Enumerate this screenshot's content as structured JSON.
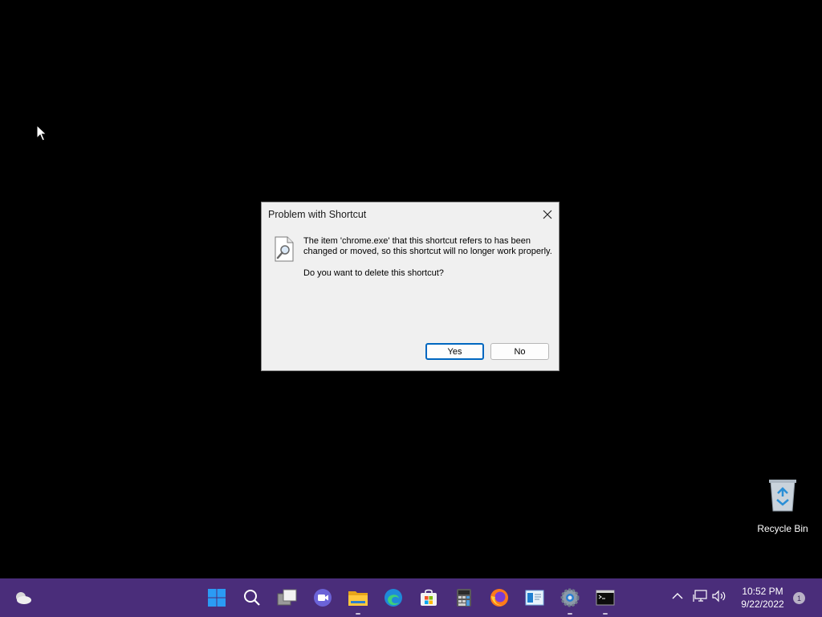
{
  "dialog": {
    "title": "Problem with Shortcut",
    "message": "The item 'chrome.exe' that this shortcut refers to has been changed or moved, so this shortcut will no longer work properly.",
    "question": "Do you want to delete this shortcut?",
    "yes_label": "Yes",
    "no_label": "No"
  },
  "desktop": {
    "recycle_bin_label": "Recycle Bin"
  },
  "taskbar": {
    "apps": [
      "weather-icon",
      "start-icon",
      "search-icon",
      "task-view-icon",
      "chat-icon",
      "file-explorer-icon",
      "edge-icon",
      "store-icon",
      "calculator-icon",
      "firefox-icon",
      "notepad-icon",
      "settings-icon",
      "terminal-icon"
    ],
    "clock_time": "10:52 PM",
    "clock_date": "9/22/2022",
    "notification_count": "1"
  },
  "colors": {
    "taskbar": "#4a2d7a",
    "accent": "#0067c0",
    "desktop": "#000000"
  }
}
